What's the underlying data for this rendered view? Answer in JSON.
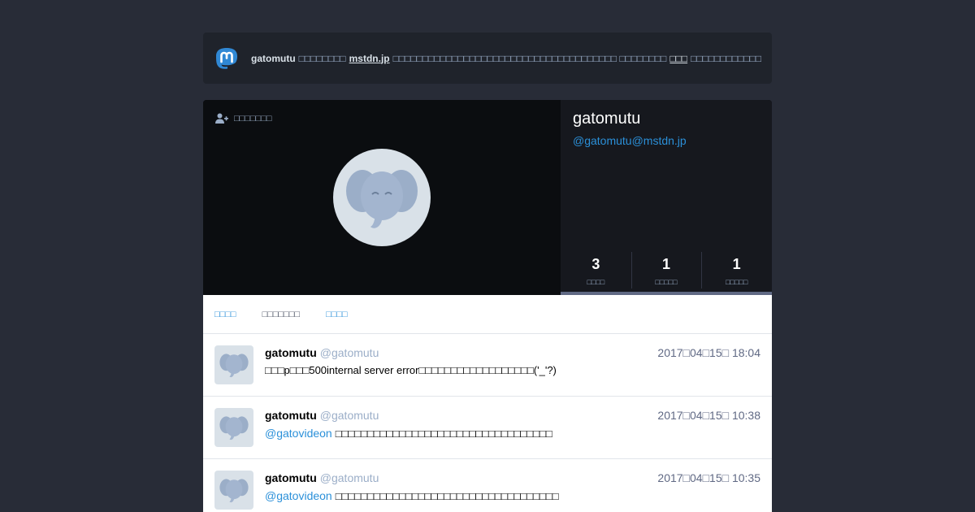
{
  "banner": {
    "logo_icon": "mastodon-logo",
    "username": "gatomutu",
    "text_before_domain": "□□□□□□□□",
    "domain": "mstdn.jp",
    "text_after_domain": "□□□□□□□□□□□□□□□□□□□□□□□□□□□□□□□□□□□□□□ □□□□□□□□",
    "link": "□□□",
    "text_end": "□□□□□□□□□□□□"
  },
  "profile": {
    "follow_label": "□□□□□□□",
    "follow_icon": "user-plus-icon",
    "display_name": "gatomutu",
    "acct": "@gatomutu@mstdn.jp",
    "counters": [
      {
        "value": "3",
        "label": "□□□□"
      },
      {
        "value": "1",
        "label": "□□□□□"
      },
      {
        "value": "1",
        "label": "□□□□□"
      }
    ]
  },
  "tabs": [
    {
      "label": "□□□□"
    },
    {
      "label": "□□□□□□□"
    },
    {
      "label": "□□□□"
    }
  ],
  "statuses": [
    {
      "name": "gatomutu",
      "acct": "@gatomutu",
      "time": "2017□04□15□ 18:04",
      "mention": "",
      "text": "□□□p□□□500internal server error□□□□□□□□□□□□□□□□□□('_'?)"
    },
    {
      "name": "gatomutu",
      "acct": "@gatomutu",
      "time": "2017□04□15□ 10:38",
      "mention": "@gatovideon",
      "text": "□□□□□□□□□□□□□□□□□□□□□□□□□□□□□□□□□□"
    },
    {
      "name": "gatomutu",
      "acct": "@gatomutu",
      "time": "2017□04□15□ 10:35",
      "mention": "@gatovideon",
      "text": "□□□□□□□□□□□□□□□□□□□□□□□□□□□□□□□□□□□"
    }
  ],
  "colors": {
    "background": "#282c37",
    "accent": "#2b90d9",
    "secondary_text": "#9baec8"
  }
}
